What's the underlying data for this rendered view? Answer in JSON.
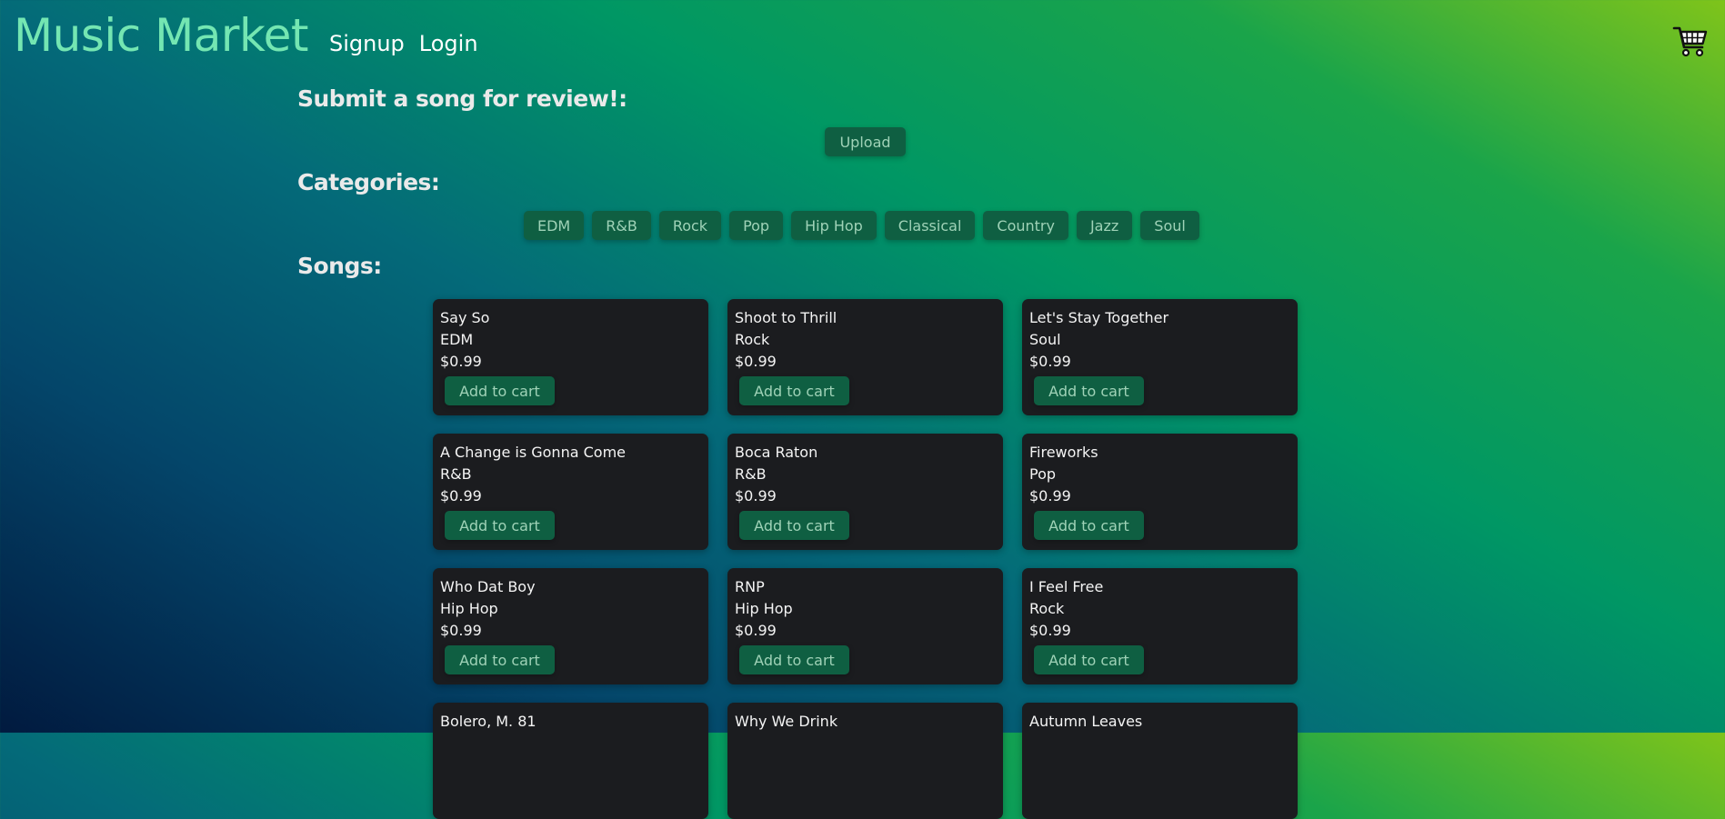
{
  "header": {
    "brand": "Music Market",
    "nav": [
      "Signup",
      "Login"
    ],
    "cart_icon": "shopping-cart-icon"
  },
  "submit_section": {
    "heading": "Submit a song for review!:",
    "upload_label": "Upload"
  },
  "categories_section": {
    "heading": "Categories:",
    "items": [
      "EDM",
      "R&B",
      "Rock",
      "Pop",
      "Hip Hop",
      "Classical",
      "Country",
      "Jazz",
      "Soul"
    ]
  },
  "songs_section": {
    "heading": "Songs:",
    "add_label": "Add to cart",
    "items": [
      {
        "title": "Say So",
        "genre": "EDM",
        "price": "$0.99"
      },
      {
        "title": "Shoot to Thrill",
        "genre": "Rock",
        "price": "$0.99"
      },
      {
        "title": "Let's Stay Together",
        "genre": "Soul",
        "price": "$0.99"
      },
      {
        "title": "A Change is Gonna Come",
        "genre": "R&B",
        "price": "$0.99"
      },
      {
        "title": "Boca Raton",
        "genre": "R&B",
        "price": "$0.99"
      },
      {
        "title": "Fireworks",
        "genre": "Pop",
        "price": "$0.99"
      },
      {
        "title": "Who Dat Boy",
        "genre": "Hip Hop",
        "price": "$0.99"
      },
      {
        "title": "RNP",
        "genre": "Hip Hop",
        "price": "$0.99"
      },
      {
        "title": "I Feel Free",
        "genre": "Rock",
        "price": "$0.99"
      },
      {
        "title": "Bolero, M. 81",
        "genre": "",
        "price": ""
      },
      {
        "title": "Why We Drink",
        "genre": "",
        "price": ""
      },
      {
        "title": "Autumn Leaves",
        "genre": "",
        "price": ""
      }
    ]
  },
  "colors": {
    "brand": "#74e6b2",
    "button_bg": "#0f5f42",
    "button_text": "#9fd2b7",
    "card_bg": "#1b1c1f"
  }
}
